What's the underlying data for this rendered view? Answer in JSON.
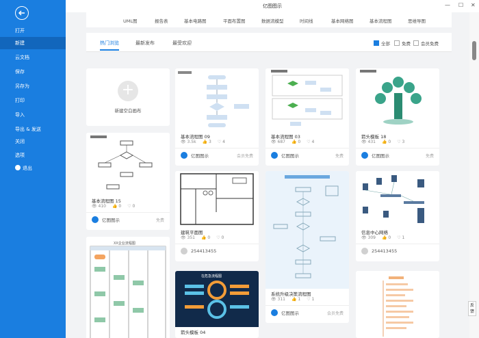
{
  "window": {
    "title": "亿图图示",
    "controls": [
      "—",
      "☐",
      "✕"
    ]
  },
  "sidebar": {
    "back_icon": "back-arrow-icon",
    "items": [
      {
        "label": "打开",
        "active": false
      },
      {
        "label": "新建",
        "active": true
      },
      {
        "label": "云文档",
        "active": false
      },
      {
        "label": "保存",
        "active": false
      },
      {
        "label": "另存为",
        "active": false
      },
      {
        "label": "打印",
        "active": false
      },
      {
        "label": "导入",
        "active": false
      },
      {
        "label": "导出 & 发送",
        "active": false
      },
      {
        "label": "关闭",
        "active": false
      },
      {
        "label": "选项",
        "active": false
      },
      {
        "label": "退出",
        "active": false
      }
    ]
  },
  "categories": [
    "UML图",
    "报告表",
    "基本电路图",
    "平面布置图",
    "数据流模型",
    "时间线",
    "基本网络图",
    "基本流程图",
    "思维导图"
  ],
  "filter": {
    "tabs": [
      "热门浏览",
      "最新发布",
      "最受欢迎"
    ],
    "active_tab": "热门浏览",
    "checks": [
      {
        "label": "全部",
        "checked": true
      },
      {
        "label": "免费",
        "checked": false
      },
      {
        "label": "会员免费",
        "checked": false
      }
    ]
  },
  "new_card": {
    "label": "新建空白画布"
  },
  "cards": [
    {
      "name": "基本流程图 09",
      "views": "3.5k",
      "likes": "3",
      "favs": "4",
      "author": "亿图图示",
      "price": "会员免费"
    },
    {
      "name": "基本流程图 03",
      "views": "687",
      "likes": "0",
      "favs": "4",
      "author": "亿图图示",
      "price": "免费"
    },
    {
      "name": "箭头模板 18",
      "views": "431",
      "likes": "0",
      "favs": "3",
      "author": "亿图图示",
      "price": "免费"
    },
    {
      "name": "基本流程图 15",
      "views": "410",
      "likes": "0",
      "favs": "0",
      "author": "亿图图示",
      "price": "免费"
    },
    {
      "name": "建筑平面图",
      "views": "351",
      "likes": "0",
      "favs": "0",
      "author": "254413455",
      "price": ""
    },
    {
      "name": "系统升级决策流程图",
      "views": "311",
      "likes": "1",
      "favs": "1",
      "author": "亿图图示",
      "price": "会员免费"
    },
    {
      "name": "信息中心网络",
      "views": "309",
      "likes": "0",
      "favs": "1",
      "author": "254413455",
      "price": ""
    },
    {
      "name": "箭头模板 04",
      "views": "",
      "likes": "",
      "favs": "",
      "author": "",
      "price": ""
    }
  ],
  "card_thumb_titles": {
    "swimlane": "XX企业流程图",
    "infographic": "在危急流程图"
  },
  "feedback_label": "反馈"
}
